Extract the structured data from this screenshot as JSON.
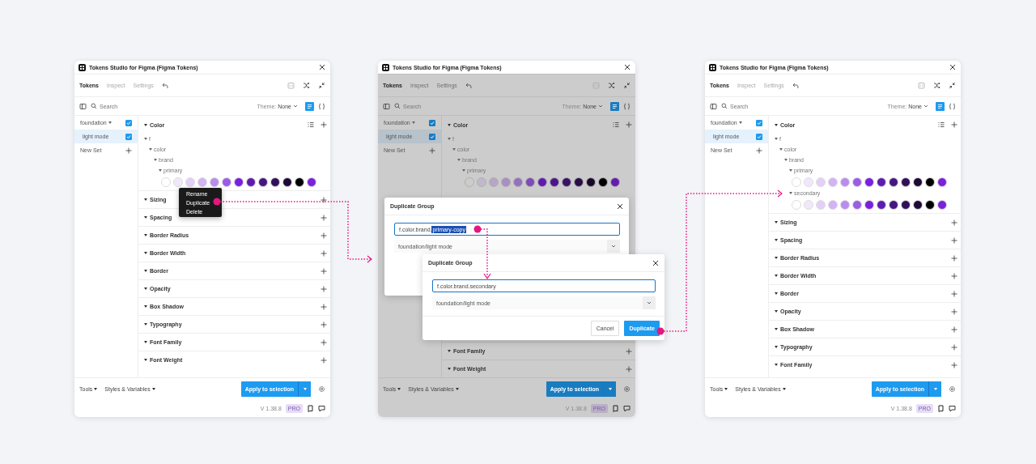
{
  "panels": [
    {
      "title": "Tokens Studio for Figma (Figma Tokens)",
      "tabs": [
        {
          "label": "Tokens",
          "selected": true
        },
        {
          "label": "Inspect",
          "selected": false
        },
        {
          "label": "Settings",
          "selected": false
        }
      ],
      "search": {
        "placeholder": "Search"
      },
      "theme": {
        "label": "Theme:",
        "value": "None"
      },
      "sets": [
        {
          "name": "foundation",
          "kind": "folder",
          "checked": true,
          "selected": false
        },
        {
          "name": "light mode",
          "kind": "set",
          "checked": true,
          "selected": true
        }
      ],
      "new_set": "New Set",
      "token_group": {
        "title": "Color",
        "expanded": true,
        "tree": [
          {
            "label": "f",
            "expanded": true,
            "children": [
              {
                "label": "color",
                "expanded": true,
                "children": [
                  {
                    "label": "brand",
                    "expanded": true,
                    "children": [
                      {
                        "label": "primary",
                        "expanded": true,
                        "swatches": [
                          {
                            "color": "#ffffff"
                          },
                          {
                            "color": "#f1e7fc"
                          },
                          {
                            "color": "#e3d0f8"
                          },
                          {
                            "color": "#d2b3f3"
                          },
                          {
                            "color": "#b98cee"
                          },
                          {
                            "color": "#9c5de5"
                          },
                          {
                            "color": "#7b1fdf"
                          },
                          {
                            "color": "#5e1bb0"
                          },
                          {
                            "color": "#461781"
                          },
                          {
                            "color": "#321059"
                          },
                          {
                            "color": "#1e0b35"
                          },
                          {
                            "color": "#000000"
                          },
                          {
                            "color": "#7a23d9"
                          }
                        ]
                      }
                    ]
                  }
                ]
              }
            ]
          }
        ]
      },
      "categories": [
        "Sizing",
        "Spacing",
        "Border Radius",
        "Border Width",
        "Border",
        "Opacity",
        "Box Shadow",
        "Typography",
        "Font Family",
        "Font Weight"
      ],
      "context_menu": [
        "Rename",
        "Duplicate",
        "Delete"
      ],
      "footer": {
        "menus": [
          "Tools",
          "Styles & Variables"
        ],
        "apply": "Apply to selection",
        "version": "V 1.38.8",
        "badge": "PRO"
      }
    },
    {
      "title": "Tokens Studio for Figma (Figma Tokens)",
      "dimmed": true,
      "tabs": [
        {
          "label": "Tokens",
          "selected": true
        },
        {
          "label": "Inspect",
          "selected": false
        },
        {
          "label": "Settings",
          "selected": false
        }
      ],
      "search": {
        "placeholder": "Search"
      },
      "theme": {
        "label": "Theme:",
        "value": "None"
      },
      "sets": [
        {
          "name": "foundation",
          "kind": "folder",
          "checked": true,
          "selected": false
        },
        {
          "name": "light mode",
          "kind": "set",
          "checked": true,
          "selected": true
        }
      ],
      "new_set": "New Set",
      "token_group": {
        "title": "Color",
        "expanded": true,
        "tree": [
          {
            "label": "f",
            "expanded": true,
            "children": [
              {
                "label": "color",
                "expanded": true,
                "children": [
                  {
                    "label": "brand",
                    "expanded": true,
                    "children": [
                      {
                        "label": "primary",
                        "expanded": true,
                        "swatches": [
                          {
                            "color": "#cccccc"
                          },
                          {
                            "color": "#c1b9ca"
                          },
                          {
                            "color": "#b6a6c6"
                          },
                          {
                            "color": "#a88fc2"
                          },
                          {
                            "color": "#9470be"
                          },
                          {
                            "color": "#7d4ab7"
                          },
                          {
                            "color": "#6219b2"
                          },
                          {
                            "color": "#4b168d"
                          },
                          {
                            "color": "#381267"
                          },
                          {
                            "color": "#280d47"
                          },
                          {
                            "color": "#18092a"
                          },
                          {
                            "color": "#000000"
                          },
                          {
                            "color": "#621cae"
                          }
                        ]
                      }
                    ]
                  }
                ]
              }
            ]
          }
        ]
      },
      "categories": [
        "Font Family",
        "Font Weight"
      ],
      "dialogs": [
        {
          "title": "Duplicate Group",
          "field": {
            "focused": true,
            "parts": [
              {
                "text": "f.color.brand.",
                "selected": false
              },
              {
                "text": "primary-copy",
                "selected": true
              }
            ]
          },
          "select": "foundation/light mode"
        },
        {
          "title": "Duplicate Group",
          "field": {
            "focused": true,
            "parts": [
              {
                "text": "f.color.brand.secondary",
                "selected": false
              }
            ]
          },
          "select": "foundation/light mode",
          "buttons": [
            {
              "label": "Cancel",
              "kind": "secondary"
            },
            {
              "label": "Duplicate",
              "kind": "primary"
            }
          ]
        }
      ],
      "footer": {
        "menus": [
          "Tools",
          "Styles & Variables"
        ],
        "apply": "Apply to selection",
        "version": "V 1.38.8",
        "badge": "PRO"
      }
    },
    {
      "title": "Tokens Studio for Figma (Figma Tokens)",
      "tabs": [
        {
          "label": "Tokens",
          "selected": true
        },
        {
          "label": "Inspect",
          "selected": false
        },
        {
          "label": "Settings",
          "selected": false
        }
      ],
      "search": {
        "placeholder": "Search"
      },
      "theme": {
        "label": "Theme:",
        "value": "None"
      },
      "sets": [
        {
          "name": "foundation",
          "kind": "folder",
          "checked": true,
          "selected": false
        },
        {
          "name": "light mode",
          "kind": "set",
          "checked": true,
          "selected": true
        }
      ],
      "new_set": "New Set",
      "token_group": {
        "title": "Color",
        "expanded": true,
        "tree": [
          {
            "label": "f",
            "expanded": true,
            "children": [
              {
                "label": "color",
                "expanded": true,
                "children": [
                  {
                    "label": "brand",
                    "expanded": true,
                    "children": [
                      {
                        "label": "primary",
                        "expanded": true,
                        "swatches": [
                          {
                            "color": "#ffffff"
                          },
                          {
                            "color": "#f1e7fc"
                          },
                          {
                            "color": "#e3d0f8"
                          },
                          {
                            "color": "#d2b3f3"
                          },
                          {
                            "color": "#b98cee"
                          },
                          {
                            "color": "#9c5de5"
                          },
                          {
                            "color": "#7b1fdf"
                          },
                          {
                            "color": "#5e1bb0"
                          },
                          {
                            "color": "#461781"
                          },
                          {
                            "color": "#321059"
                          },
                          {
                            "color": "#1e0b35"
                          },
                          {
                            "color": "#000000"
                          },
                          {
                            "color": "#7a23d9"
                          }
                        ]
                      },
                      {
                        "label": "secondary",
                        "expanded": true,
                        "swatches": [
                          {
                            "color": "#ffffff"
                          },
                          {
                            "color": "#f1e7fc"
                          },
                          {
                            "color": "#e3d0f8"
                          },
                          {
                            "color": "#d2b3f3"
                          },
                          {
                            "color": "#b98cee"
                          },
                          {
                            "color": "#9c5de5"
                          },
                          {
                            "color": "#7b1fdf"
                          },
                          {
                            "color": "#5e1bb0"
                          },
                          {
                            "color": "#461781"
                          },
                          {
                            "color": "#321059"
                          },
                          {
                            "color": "#1e0b35"
                          },
                          {
                            "color": "#000000"
                          },
                          {
                            "color": "#7a23d9"
                          }
                        ]
                      }
                    ]
                  }
                ]
              }
            ]
          }
        ]
      },
      "categories": [
        "Sizing",
        "Spacing",
        "Border Radius",
        "Border Width",
        "Border",
        "Opacity",
        "Box Shadow",
        "Typography",
        "Font Family"
      ],
      "footer": {
        "menus": [
          "Tools",
          "Styles & Variables"
        ],
        "apply": "Apply to selection",
        "version": "V 1.38.8",
        "badge": "PRO"
      }
    }
  ]
}
